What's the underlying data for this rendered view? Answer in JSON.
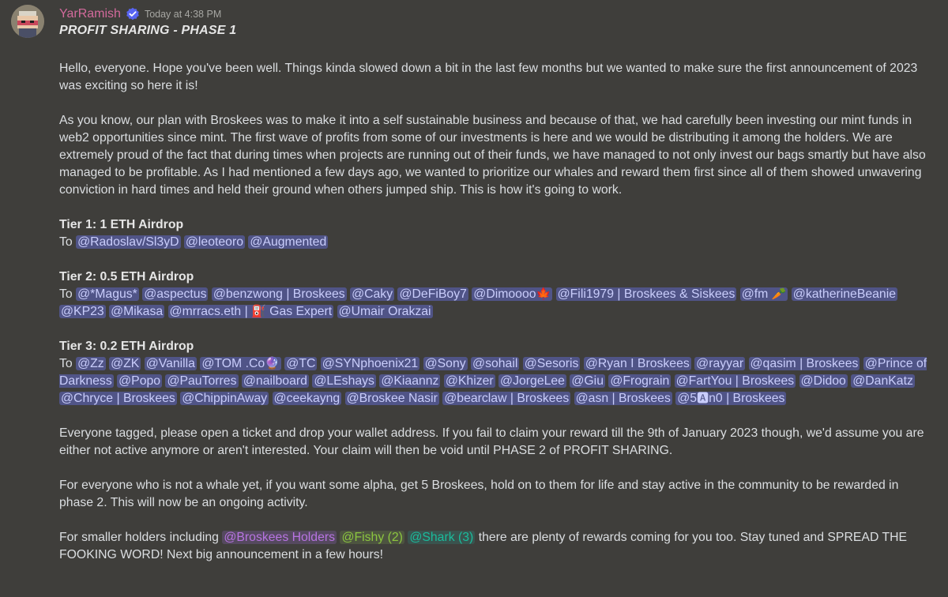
{
  "message": {
    "author": "YarRamish",
    "timestamp": "Today at 4:38 PM",
    "title": "PROFIT SHARING - PHASE 1",
    "paragraph1": "Hello, everyone. Hope you've been well. Things kinda slowed down a bit in the last few months but we wanted to make sure the first announcement of 2023 was exciting so here it is!",
    "paragraph2": "As you know, our plan with Broskees was to make it into a self sustainable business and because of that, we had carefully been investing our mint funds in web2 opportunities since mint. The first wave of profits from some of our investments is here and we would be distributing it among the holders. We are extremely proud of the fact that during times when projects are running out of their funds, we have managed to not only invest our bags smartly but have also managed to be profitable. As I had mentioned a few days ago, we wanted to prioritize our whales and reward them first since all of them showed unwavering conviction in hard times and held their ground when others jumped ship. This is how it's going to work.",
    "to_prefix": "To",
    "tier1": {
      "title": "Tier 1: 1 ETH Airdrop",
      "mentions": [
        "@Radoslav/Sl3yD",
        "@leoteoro",
        "@Augmented"
      ]
    },
    "tier2": {
      "title": "Tier 2: 0.5 ETH Airdrop",
      "mentions": [
        "@*Magus*",
        "@aspectus",
        "@benzwong | Broskees",
        "@Caky",
        "@DeFiBoy7",
        "@Dimoooo",
        "@Fili1979 | Broskees & Siskees",
        "@fm",
        "@katherineBeanie",
        "@KP23",
        "@Mikasa",
        "@mrracs.eth |",
        "Gas Expert",
        "@Umair Orakzai"
      ],
      "emojis": {
        "dimoooo": "🍁",
        "fm": "🥕",
        "gas": "⛽"
      }
    },
    "tier3": {
      "title": "Tier 3: 0.2 ETH Airdrop",
      "mentions": [
        "@Zz",
        "@ZK",
        "@Vanilla",
        "@TOM .Co",
        "@TC",
        "@SYNphoenix21",
        "@Sony",
        "@sohail",
        "@Sesoris",
        "@Ryan I Broskees",
        "@rayyar",
        "@qasim | Broskees",
        "@Prince of Darkness",
        "@Popo",
        "@PauTorres",
        "@nailboard",
        "@LEshays",
        "@Kiaannz",
        "@Khizer",
        "@JorgeLee",
        "@Giu",
        "@Frograin",
        "@FartYou | Broskees",
        "@Didoo",
        "@DanKatz",
        "@Chryce | Broskees",
        "@ChippinAway",
        "@ceekayng",
        "@Broskee Nasir",
        "@bearclaw | Broskees",
        "@asn | Broskees",
        "@5",
        "n0 | Broskees"
      ],
      "emojis": {
        "tom": "🔮",
        "a_button": "🅰"
      }
    },
    "paragraph3": "Everyone tagged, please open a ticket and drop your wallet address. If you fail to claim your reward till the 9th of January 2023 though, we'd assume you are either not active anymore or aren't interested. Your claim will then be void until PHASE 2 of PROFIT SHARING.",
    "paragraph4": "For everyone who is not a whale yet, if you want some alpha, get 5 Broskees, hold on to them for life and stay active in the community to be rewarded in phase 2. This will now be an ongoing activity.",
    "paragraph5_prefix": "For smaller holders including",
    "roles": [
      "@Broskees Holders",
      "@Fishy (2)",
      "@Shark (3)"
    ],
    "paragraph5_suffix": "there are plenty of rewards coming for you too. Stay tuned and SPREAD THE FOOKING WORD! Next big announcement in a few hours!"
  },
  "colors": {
    "background": "#3f3e3b",
    "username": "#d36a9c",
    "mention_bg": "#505487",
    "mention_text": "#c9cdfb",
    "role_holders": "#b874e2",
    "role_fishy": "#8cc63f",
    "role_shark": "#1abc9c",
    "verified_badge": "#5865f2"
  },
  "icons": {
    "verified": "verified-badge-icon",
    "avatar": "pixel-avatar"
  }
}
